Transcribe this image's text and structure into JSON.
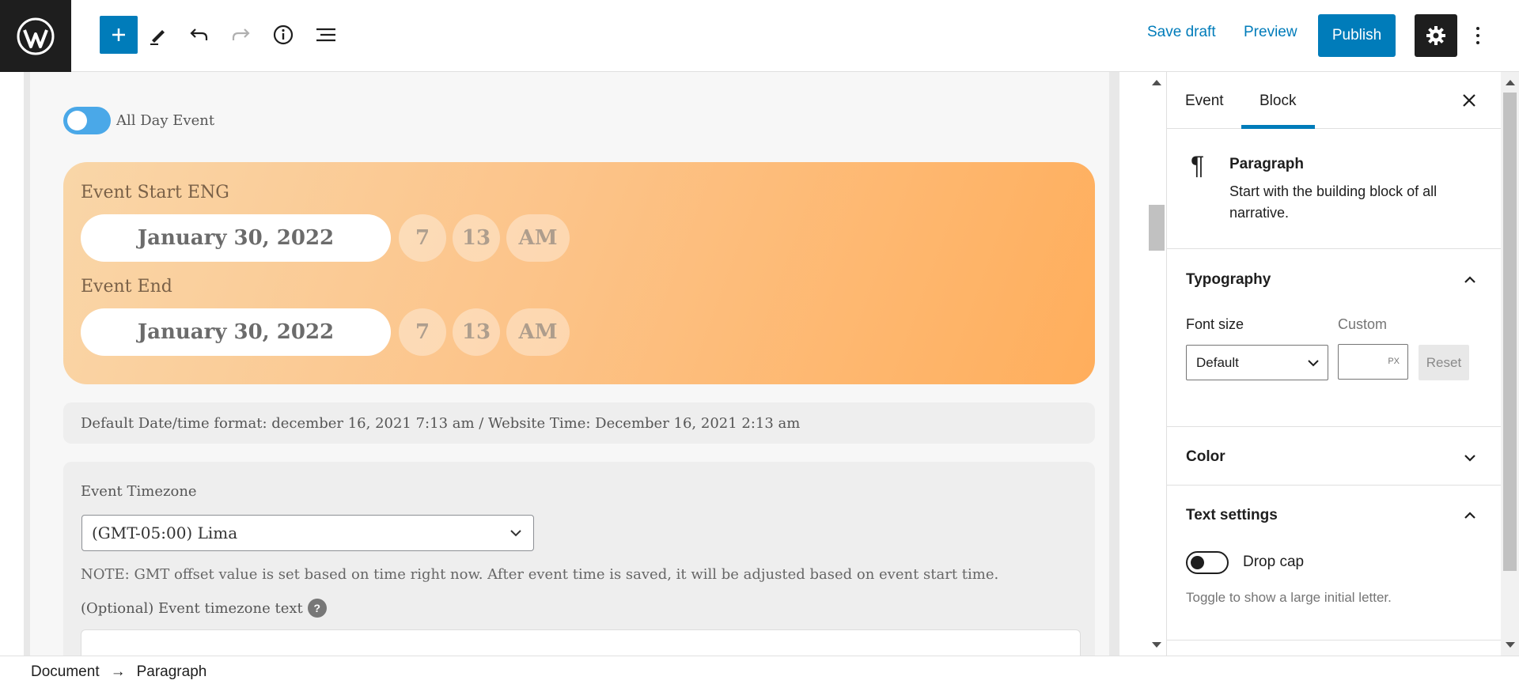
{
  "toolbar": {
    "save_draft": "Save draft",
    "preview": "Preview",
    "publish": "Publish",
    "icons": [
      "wordpress-logo",
      "plus-icon",
      "pencil-icon",
      "undo-icon",
      "redo-icon",
      "info-icon",
      "list-view-icon",
      "gear-icon",
      "more-vertical-icon"
    ]
  },
  "event": {
    "all_day_label": "All Day Event",
    "start_label": "Event Start ENG",
    "start_date": "January 30, 2022",
    "start_hour": "7",
    "start_minute": "13",
    "start_ampm": "AM",
    "end_label": "Event End",
    "end_date": "January 30, 2022",
    "end_hour": "7",
    "end_minute": "13",
    "end_ampm": "AM",
    "format_info": "Default Date/time format: december 16, 2021 7:13 am / Website Time: December 16, 2021 2:13 am",
    "timezone_label": "Event Timezone",
    "timezone_value": "(GMT-05:00) Lima",
    "timezone_note": "NOTE: GMT offset value is set based on time right now. After event time is saved, it will be adjusted based on event start time.",
    "timezone_text_label": "(Optional) Event timezone text",
    "help_mark": "?",
    "timezone_text_value": ""
  },
  "sidebar": {
    "tabs": [
      "Event",
      "Block"
    ],
    "active_tab": "Block",
    "block": {
      "icon_glyph": "¶",
      "title": "Paragraph",
      "description": "Start with the building block of all narrative."
    },
    "typography": {
      "title": "Typography",
      "font_size_label": "Font size",
      "custom_label": "Custom",
      "font_size_value": "Default",
      "unit": "PX",
      "reset": "Reset"
    },
    "color": {
      "title": "Color"
    },
    "text_settings": {
      "title": "Text settings",
      "drop_cap_label": "Drop cap",
      "drop_cap_help": "Toggle to show a large initial letter."
    }
  },
  "breadcrumb": {
    "items": [
      "Document",
      "Paragraph"
    ],
    "separator": "→"
  },
  "colors": {
    "accent": "#007cba",
    "toggle_on": "#4aa8e8",
    "orange_start": "#f9d6a8",
    "orange_end": "#ffae5c"
  }
}
